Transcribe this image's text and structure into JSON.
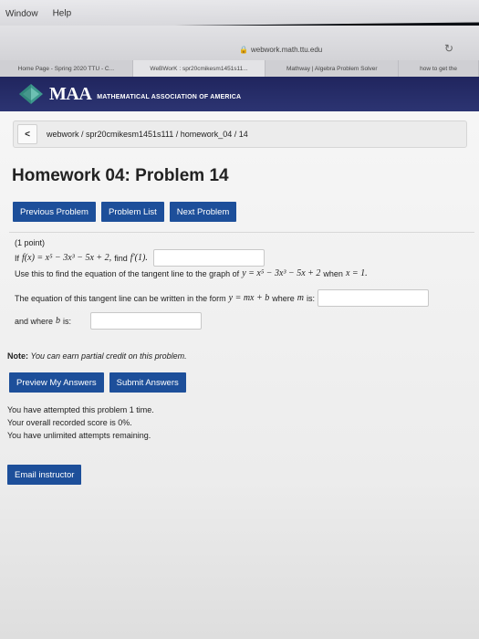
{
  "menubar": {
    "items": [
      "Window",
      "Help"
    ]
  },
  "browser": {
    "url": "webwork.math.ttu.edu",
    "tabs": [
      "Home Page - Spring 2020 TTU - C...",
      "WeBWorK : spr20cmikesm1451s11...",
      "Mathway | Algebra Problem Solver",
      "how to get the"
    ]
  },
  "banner": {
    "logo_text": "MAA",
    "subtitle": "MATHEMATICAL ASSOCIATION OF AMERICA"
  },
  "breadcrumb": {
    "back_label": "<",
    "path": "webwork / spr20cmikesm1451s111 / homework_04 / 14"
  },
  "page_title": "Homework 04: Problem 14",
  "nav_buttons": {
    "previous": "Previous Problem",
    "list": "Problem List",
    "next": "Next Problem"
  },
  "problem": {
    "points": "(1 point)",
    "line1_prefix": "If",
    "line1_fx": "f(x) = x⁵ − 3x³ − 5x + 2,",
    "line1_find": "find",
    "line1_deriv": "f′(1).",
    "line2_text": "Use this to find the equation of the tangent line to the graph of",
    "line2_eq": "y = x⁵ − 3x³ − 5x + 2",
    "line2_when": "when",
    "line2_x": "x = 1.",
    "line3_text": "The equation of this tangent line can be written in the form",
    "line3_form": "y = mx + b",
    "line3_where": "where",
    "line3_m": "m",
    "line3_is": "is:",
    "line4_text": "and where",
    "line4_b": "b",
    "line4_is": "is:",
    "answer_fprime": "",
    "answer_m": "",
    "answer_b": ""
  },
  "note": {
    "label": "Note:",
    "text": "You can earn partial credit on this problem."
  },
  "submit_buttons": {
    "preview": "Preview My Answers",
    "submit": "Submit Answers"
  },
  "status": [
    "You have attempted this problem 1 time.",
    "Your overall recorded score is 0%.",
    "You have unlimited attempts remaining."
  ],
  "email_button": "Email instructor",
  "colors": {
    "button_blue": "#1d4f9a",
    "banner_navy": "#22285f"
  }
}
